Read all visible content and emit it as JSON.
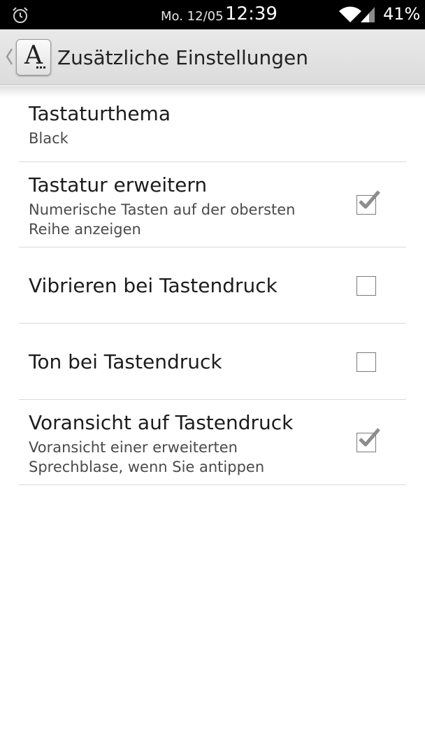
{
  "status_bar": {
    "alarm_icon": "alarm-clock-icon",
    "date": "Mo. 12/05",
    "time": "12:39",
    "wifi_icon": "wifi-icon",
    "signal_icon": "cell-signal-icon",
    "battery": "41%"
  },
  "action_bar": {
    "back_icon": "chevron-left-icon",
    "app_icon": "keyboard-font-icon",
    "app_icon_letter": "A",
    "title": "Zusätzliche Einstellungen",
    "background_color": "#e2e2e2"
  },
  "preferences": [
    {
      "title": "Tastaturthema",
      "summary": "Black",
      "has_checkbox": false
    },
    {
      "title": "Tastatur erweitern",
      "summary": "Numerische Tasten auf der obersten Reihe anzeigen",
      "has_checkbox": true,
      "checked": true
    },
    {
      "title": "Vibrieren bei Tastendruck",
      "summary": "",
      "has_checkbox": true,
      "checked": false
    },
    {
      "title": "Ton bei Tastendruck",
      "summary": "",
      "has_checkbox": true,
      "checked": false
    },
    {
      "title": "Voransicht auf Tastendruck",
      "summary": "Voransicht einer erweiterten Sprechblase, wenn Sie antippen",
      "has_checkbox": true,
      "checked": true
    }
  ],
  "colors": {
    "status_bar": "#000000",
    "divider": "#dadada",
    "checkmark": "#8c8c8c",
    "text_primary": "#1c1c1c",
    "text_secondary": "#4a4a4a"
  }
}
